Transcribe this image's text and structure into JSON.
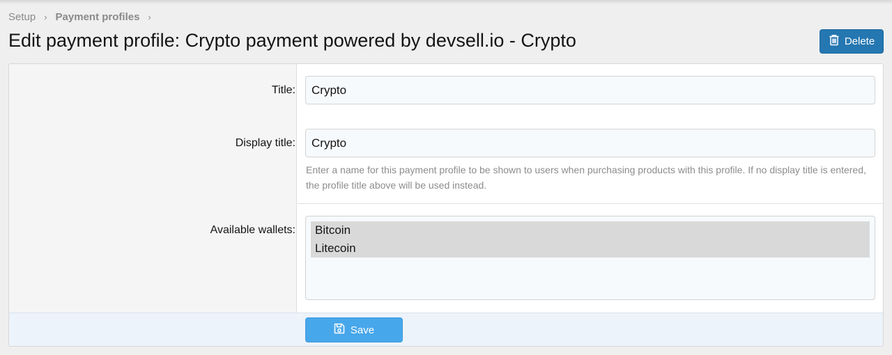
{
  "breadcrumb": {
    "items": [
      "Setup",
      "Payment profiles"
    ]
  },
  "page": {
    "title": "Edit payment profile: Crypto payment powered by devsell.io - Crypto"
  },
  "toolbar": {
    "delete_label": "Delete",
    "delete_icon": "trash-icon"
  },
  "form": {
    "title_label": "Title:",
    "title_value": "Crypto",
    "display_title_label": "Display title:",
    "display_title_value": "Crypto",
    "display_title_explain": "Enter a name for this payment profile to be shown to users when purchasing products with this profile. If no display title is entered, the profile title above will be used instead.",
    "wallets_label": "Available wallets:",
    "wallets": [
      "Bitcoin",
      "Litecoin"
    ],
    "save_label": "Save",
    "save_icon": "floppy-disk-icon"
  },
  "colors": {
    "delete_button": "#2577b1",
    "save_button": "#47a7eb",
    "selected_option": "#d9d9d9"
  }
}
